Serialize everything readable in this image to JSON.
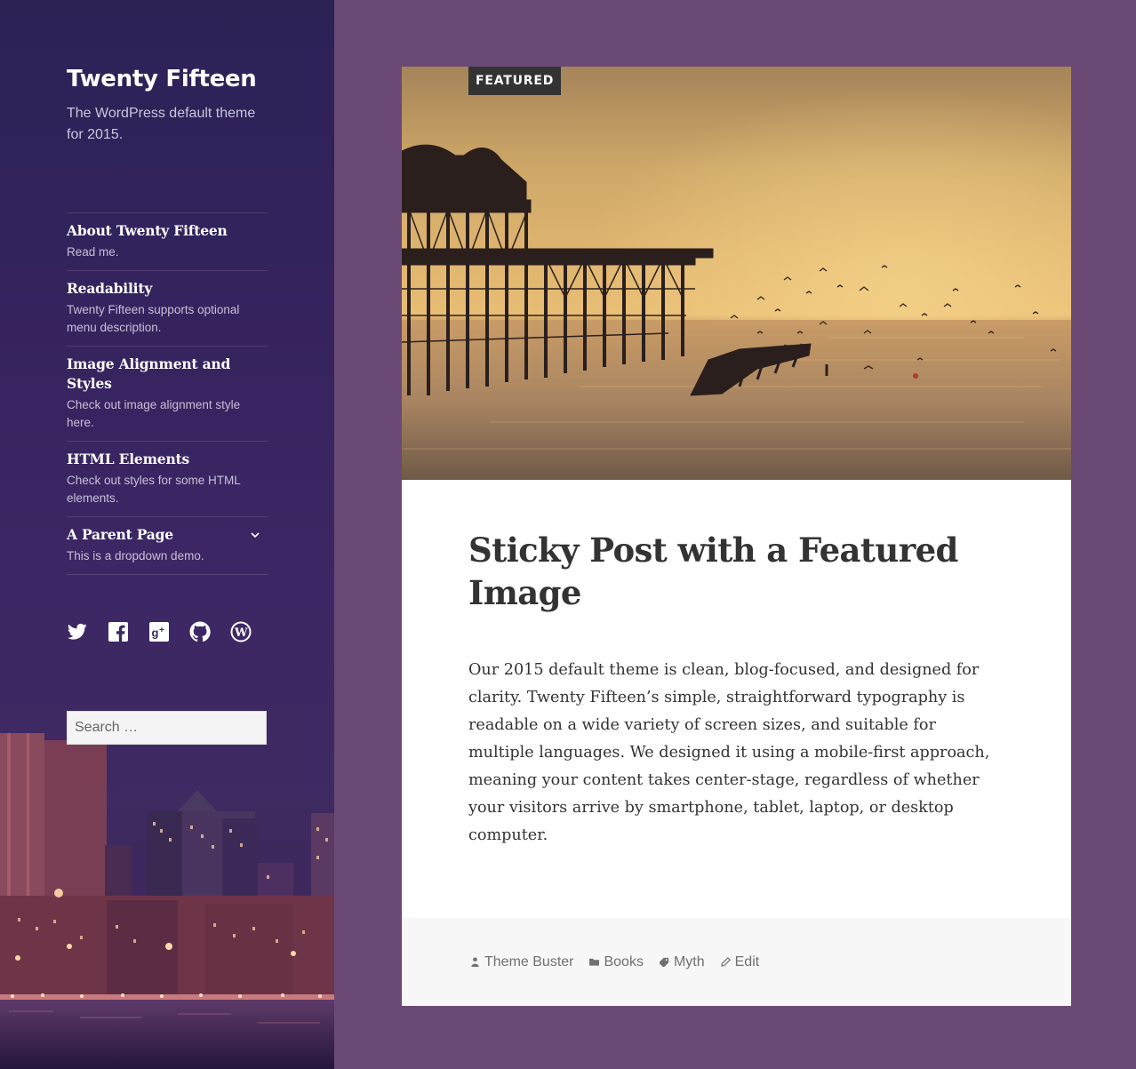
{
  "site": {
    "title": "Twenty Fifteen",
    "description": "The WordPress default theme for 2015."
  },
  "menu": {
    "items": [
      {
        "title": "About Twenty Fifteen",
        "description": "Read me."
      },
      {
        "title": "Readability",
        "description": "Twenty Fifteen supports optional menu description."
      },
      {
        "title": "Image Alignment and Styles",
        "description": "Check out image alignment style here."
      },
      {
        "title": "HTML Elements",
        "description": "Check out styles for some HTML elements."
      },
      {
        "title": "A Parent Page",
        "description": "This is a dropdown demo.",
        "has_submenu": true
      }
    ]
  },
  "social": {
    "icons": [
      "twitter-icon",
      "facebook-icon",
      "google-plus-icon",
      "github-icon",
      "wordpress-icon"
    ]
  },
  "search": {
    "placeholder": "Search …",
    "value": ""
  },
  "post": {
    "badge": "FEATURED",
    "title": "Sticky Post with a Featured Image",
    "body": "Our 2015 default theme is clean, blog-focused, and designed for clarity. Twenty Fifteen’s simple, straightforward typography is readable on a wide variety of screen sizes, and suitable for multiple languages. We designed it using a mobile-first approach, meaning your content takes center-stage, regardless of whether your visitors arrive by smartphone, tablet, laptop, or desktop computer.",
    "meta": {
      "author": "Theme Buster",
      "category": "Books",
      "tag": "Myth",
      "edit": "Edit"
    }
  },
  "colors": {
    "page_background": "#6a4a75",
    "sidebar_background": "#35235e",
    "text_dark": "#333333",
    "footer_background": "#f7f7f7"
  }
}
